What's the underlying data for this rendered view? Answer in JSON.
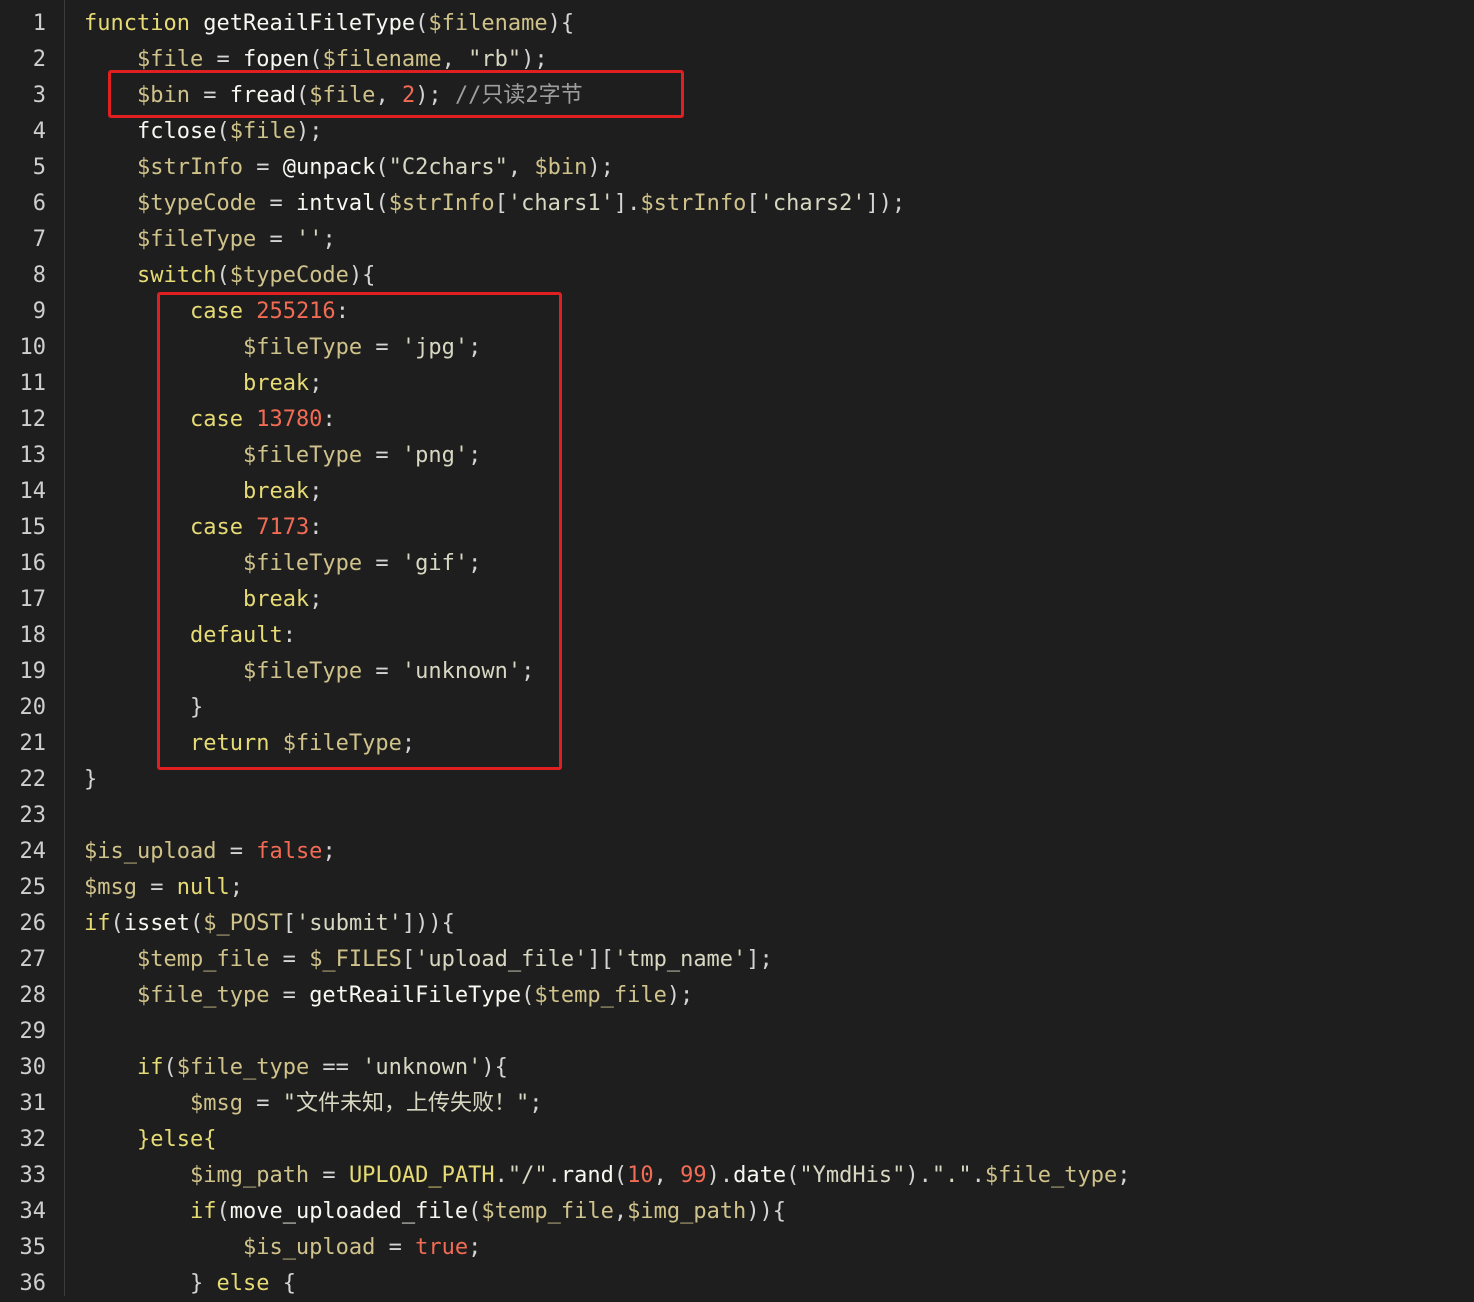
{
  "line_numbers": [
    "1",
    "2",
    "3",
    "4",
    "5",
    "6",
    "7",
    "8",
    "9",
    "10",
    "11",
    "12",
    "13",
    "14",
    "15",
    "16",
    "17",
    "18",
    "19",
    "20",
    "21",
    "22",
    "23",
    "24",
    "25",
    "26",
    "27",
    "28",
    "29",
    "30",
    "31",
    "32",
    "33",
    "34",
    "35",
    "36"
  ],
  "lines": [
    [
      {
        "t": "function ",
        "c": "kw"
      },
      {
        "t": "getReailFileType",
        "c": "fn"
      },
      {
        "t": "(",
        "c": "op"
      },
      {
        "t": "$filename",
        "c": "var"
      },
      {
        "t": "){",
        "c": "op"
      }
    ],
    [
      {
        "t": "    "
      },
      {
        "t": "$file",
        "c": "var"
      },
      {
        "t": " = ",
        "c": "op"
      },
      {
        "t": "fopen",
        "c": "fn"
      },
      {
        "t": "(",
        "c": "op"
      },
      {
        "t": "$filename",
        "c": "var"
      },
      {
        "t": ", ",
        "c": "op"
      },
      {
        "t": "\"rb\"",
        "c": "str"
      },
      {
        "t": ");",
        "c": "op"
      }
    ],
    [
      {
        "t": "    "
      },
      {
        "t": "$bin",
        "c": "var"
      },
      {
        "t": " = ",
        "c": "op"
      },
      {
        "t": "fread",
        "c": "fn"
      },
      {
        "t": "(",
        "c": "op"
      },
      {
        "t": "$file",
        "c": "var"
      },
      {
        "t": ", ",
        "c": "op"
      },
      {
        "t": "2",
        "c": "num"
      },
      {
        "t": "); ",
        "c": "op"
      },
      {
        "t": "//只读2字节",
        "c": "cmt"
      }
    ],
    [
      {
        "t": "    "
      },
      {
        "t": "fclose",
        "c": "fn"
      },
      {
        "t": "(",
        "c": "op"
      },
      {
        "t": "$file",
        "c": "var"
      },
      {
        "t": ");",
        "c": "op"
      }
    ],
    [
      {
        "t": "    "
      },
      {
        "t": "$strInfo",
        "c": "var"
      },
      {
        "t": " = ",
        "c": "op"
      },
      {
        "t": "@unpack",
        "c": "fn"
      },
      {
        "t": "(",
        "c": "op"
      },
      {
        "t": "\"C2chars\"",
        "c": "str"
      },
      {
        "t": ", ",
        "c": "op"
      },
      {
        "t": "$bin",
        "c": "var"
      },
      {
        "t": ");",
        "c": "op"
      }
    ],
    [
      {
        "t": "    "
      },
      {
        "t": "$typeCode",
        "c": "var"
      },
      {
        "t": " = ",
        "c": "op"
      },
      {
        "t": "intval",
        "c": "fn"
      },
      {
        "t": "(",
        "c": "op"
      },
      {
        "t": "$strInfo",
        "c": "var"
      },
      {
        "t": "[",
        "c": "op"
      },
      {
        "t": "'chars1'",
        "c": "str"
      },
      {
        "t": "].",
        "c": "op"
      },
      {
        "t": "$strInfo",
        "c": "var"
      },
      {
        "t": "[",
        "c": "op"
      },
      {
        "t": "'chars2'",
        "c": "str"
      },
      {
        "t": "]);",
        "c": "op"
      }
    ],
    [
      {
        "t": "    "
      },
      {
        "t": "$fileType",
        "c": "var"
      },
      {
        "t": " = ",
        "c": "op"
      },
      {
        "t": "''",
        "c": "str"
      },
      {
        "t": ";",
        "c": "op"
      }
    ],
    [
      {
        "t": "    "
      },
      {
        "t": "switch",
        "c": "kw"
      },
      {
        "t": "(",
        "c": "op"
      },
      {
        "t": "$typeCode",
        "c": "var"
      },
      {
        "t": "){",
        "c": "op"
      }
    ],
    [
      {
        "t": "        "
      },
      {
        "t": "case ",
        "c": "kw"
      },
      {
        "t": "255216",
        "c": "num"
      },
      {
        "t": ":",
        "c": "op"
      }
    ],
    [
      {
        "t": "            "
      },
      {
        "t": "$fileType",
        "c": "var"
      },
      {
        "t": " = ",
        "c": "op"
      },
      {
        "t": "'jpg'",
        "c": "str"
      },
      {
        "t": ";",
        "c": "op"
      }
    ],
    [
      {
        "t": "            "
      },
      {
        "t": "break",
        "c": "kw"
      },
      {
        "t": ";",
        "c": "op"
      }
    ],
    [
      {
        "t": "        "
      },
      {
        "t": "case ",
        "c": "kw"
      },
      {
        "t": "13780",
        "c": "num"
      },
      {
        "t": ":",
        "c": "op"
      }
    ],
    [
      {
        "t": "            "
      },
      {
        "t": "$fileType",
        "c": "var"
      },
      {
        "t": " = ",
        "c": "op"
      },
      {
        "t": "'png'",
        "c": "str"
      },
      {
        "t": ";",
        "c": "op"
      }
    ],
    [
      {
        "t": "            "
      },
      {
        "t": "break",
        "c": "kw"
      },
      {
        "t": ";",
        "c": "op"
      }
    ],
    [
      {
        "t": "        "
      },
      {
        "t": "case ",
        "c": "kw"
      },
      {
        "t": "7173",
        "c": "num"
      },
      {
        "t": ":",
        "c": "op"
      }
    ],
    [
      {
        "t": "            "
      },
      {
        "t": "$fileType",
        "c": "var"
      },
      {
        "t": " = ",
        "c": "op"
      },
      {
        "t": "'gif'",
        "c": "str"
      },
      {
        "t": ";",
        "c": "op"
      }
    ],
    [
      {
        "t": "            "
      },
      {
        "t": "break",
        "c": "kw"
      },
      {
        "t": ";",
        "c": "op"
      }
    ],
    [
      {
        "t": "        "
      },
      {
        "t": "default",
        "c": "kw"
      },
      {
        "t": ":",
        "c": "op"
      }
    ],
    [
      {
        "t": "            "
      },
      {
        "t": "$fileType",
        "c": "var"
      },
      {
        "t": " = ",
        "c": "op"
      },
      {
        "t": "'unknown'",
        "c": "str"
      },
      {
        "t": ";",
        "c": "op"
      }
    ],
    [
      {
        "t": "        "
      },
      {
        "t": "}",
        "c": "op"
      }
    ],
    [
      {
        "t": "        "
      },
      {
        "t": "return ",
        "c": "kw"
      },
      {
        "t": "$fileType",
        "c": "var"
      },
      {
        "t": ";",
        "c": "op"
      }
    ],
    [
      {
        "t": "}",
        "c": "op"
      }
    ],
    [],
    [
      {
        "t": "$is_upload",
        "c": "var"
      },
      {
        "t": " = ",
        "c": "op"
      },
      {
        "t": "false",
        "c": "num"
      },
      {
        "t": ";",
        "c": "op"
      }
    ],
    [
      {
        "t": "$msg",
        "c": "var"
      },
      {
        "t": " = ",
        "c": "op"
      },
      {
        "t": "null",
        "c": "kw"
      },
      {
        "t": ";",
        "c": "op"
      }
    ],
    [
      {
        "t": "if",
        "c": "kw"
      },
      {
        "t": "(",
        "c": "op"
      },
      {
        "t": "isset",
        "c": "fn"
      },
      {
        "t": "(",
        "c": "op"
      },
      {
        "t": "$_POST",
        "c": "var"
      },
      {
        "t": "[",
        "c": "op"
      },
      {
        "t": "'submit'",
        "c": "str"
      },
      {
        "t": "])){",
        "c": "op"
      }
    ],
    [
      {
        "t": "    "
      },
      {
        "t": "$temp_file",
        "c": "var"
      },
      {
        "t": " = ",
        "c": "op"
      },
      {
        "t": "$_FILES",
        "c": "var"
      },
      {
        "t": "[",
        "c": "op"
      },
      {
        "t": "'upload_file'",
        "c": "str"
      },
      {
        "t": "][",
        "c": "op"
      },
      {
        "t": "'tmp_name'",
        "c": "str"
      },
      {
        "t": "];",
        "c": "op"
      }
    ],
    [
      {
        "t": "    "
      },
      {
        "t": "$file_type",
        "c": "var"
      },
      {
        "t": " = ",
        "c": "op"
      },
      {
        "t": "getReailFileType",
        "c": "fn"
      },
      {
        "t": "(",
        "c": "op"
      },
      {
        "t": "$temp_file",
        "c": "var"
      },
      {
        "t": ");",
        "c": "op"
      }
    ],
    [],
    [
      {
        "t": "    "
      },
      {
        "t": "if",
        "c": "kw"
      },
      {
        "t": "(",
        "c": "op"
      },
      {
        "t": "$file_type",
        "c": "var"
      },
      {
        "t": " == ",
        "c": "op"
      },
      {
        "t": "'unknown'",
        "c": "str"
      },
      {
        "t": "){",
        "c": "op"
      }
    ],
    [
      {
        "t": "        "
      },
      {
        "t": "$msg",
        "c": "var"
      },
      {
        "t": " = ",
        "c": "op"
      },
      {
        "t": "\"文件未知，上传失败！\"",
        "c": "str"
      },
      {
        "t": ";",
        "c": "op"
      }
    ],
    [
      {
        "t": "    "
      },
      {
        "t": "}else{",
        "c": "kw"
      }
    ],
    [
      {
        "t": "        "
      },
      {
        "t": "$img_path",
        "c": "var"
      },
      {
        "t": " = ",
        "c": "op"
      },
      {
        "t": "UPLOAD_PATH",
        "c": "kw"
      },
      {
        "t": ".",
        "c": "op"
      },
      {
        "t": "\"/\"",
        "c": "str"
      },
      {
        "t": ".",
        "c": "op"
      },
      {
        "t": "rand",
        "c": "fn"
      },
      {
        "t": "(",
        "c": "op"
      },
      {
        "t": "10",
        "c": "num"
      },
      {
        "t": ", ",
        "c": "op"
      },
      {
        "t": "99",
        "c": "num"
      },
      {
        "t": ").",
        "c": "op"
      },
      {
        "t": "date",
        "c": "fn"
      },
      {
        "t": "(",
        "c": "op"
      },
      {
        "t": "\"YmdHis\"",
        "c": "str"
      },
      {
        "t": ").",
        "c": "op"
      },
      {
        "t": "\".\"",
        "c": "str"
      },
      {
        "t": ".",
        "c": "op"
      },
      {
        "t": "$file_type",
        "c": "var"
      },
      {
        "t": ";",
        "c": "op"
      }
    ],
    [
      {
        "t": "        "
      },
      {
        "t": "if",
        "c": "kw"
      },
      {
        "t": "(",
        "c": "op"
      },
      {
        "t": "move_uploaded_file",
        "c": "fn"
      },
      {
        "t": "(",
        "c": "op"
      },
      {
        "t": "$temp_file",
        "c": "var"
      },
      {
        "t": ",",
        "c": "op"
      },
      {
        "t": "$img_path",
        "c": "var"
      },
      {
        "t": ")){",
        "c": "op"
      }
    ],
    [
      {
        "t": "            "
      },
      {
        "t": "$is_upload",
        "c": "var"
      },
      {
        "t": " = ",
        "c": "op"
      },
      {
        "t": "true",
        "c": "num"
      },
      {
        "t": ";",
        "c": "op"
      }
    ],
    [
      {
        "t": "        "
      },
      {
        "t": "} ",
        "c": "op"
      },
      {
        "t": "else",
        "c": "kw"
      },
      {
        "t": " {",
        "c": "op"
      }
    ]
  ],
  "colors": {
    "background": "#1e1e1e",
    "highlight_border": "#e02020",
    "keyword": "#e6db74",
    "variable": "#cfc28a",
    "number": "#f26b54",
    "comment": "#9e9e9e"
  }
}
